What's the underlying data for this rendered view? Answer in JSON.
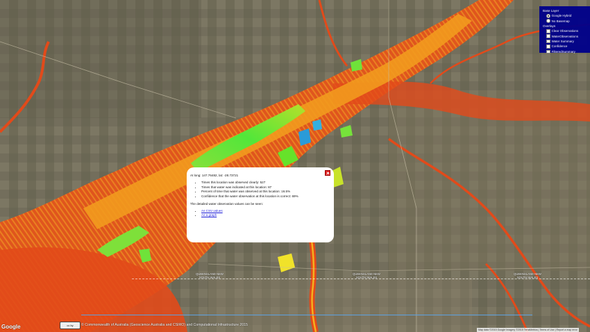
{
  "layer_switcher": {
    "base_layer_title": "Base Layer",
    "base_layers": [
      {
        "label": "Google Hybrid",
        "selected": true
      },
      {
        "label": "No Basemap",
        "selected": false
      }
    ],
    "overlays_title": "Overlays",
    "overlays": [
      {
        "label": "Clear Observations",
        "checked": false
      },
      {
        "label": "WaterObservations",
        "checked": false
      },
      {
        "label": "Water Summary",
        "checked": false
      },
      {
        "label": "Confidence",
        "checked": false
      },
      {
        "label": "FilteredSummary",
        "checked": false
      }
    ]
  },
  "popup": {
    "coords": "At long: 147.76482, lat: -28.73721",
    "stats": [
      "Times this location was observed clearly: 527",
      "Times that water was indicated at this location: 87",
      "Percent of time that water was observed at this location: 16.5%",
      "Confidence that the water observation at this location is correct: 69%"
    ],
    "lead": "The detailed water observation values can be seen:",
    "links": [
      "As CSV values",
      "As a graph"
    ]
  },
  "state_labels": [
    "QUEENSLAND NEW SOUTH WALES",
    "QUEENSLAND NEW SOUTH WALES",
    "QUEENSLAND NEW SOUTH WALES",
    "QUEENSLAND NEW SOUTH WALES"
  ],
  "attribution": "© Commonwealth of Australia (Geoscience Australia and CSIRO) and Computational Infrastructure 2015",
  "cc_badge": "cc by",
  "google_logo": "Google",
  "map_data": "Map data ©2015 Google Imagery ©2015 TerraMetrics | Terms of Use | Report a map error",
  "colors": {
    "water_low": "#e2431a",
    "water_mid": "#f7a21c",
    "water_high": "#66e22a",
    "water_max": "#2a9bd8",
    "switcher_bg": "#00008b"
  }
}
